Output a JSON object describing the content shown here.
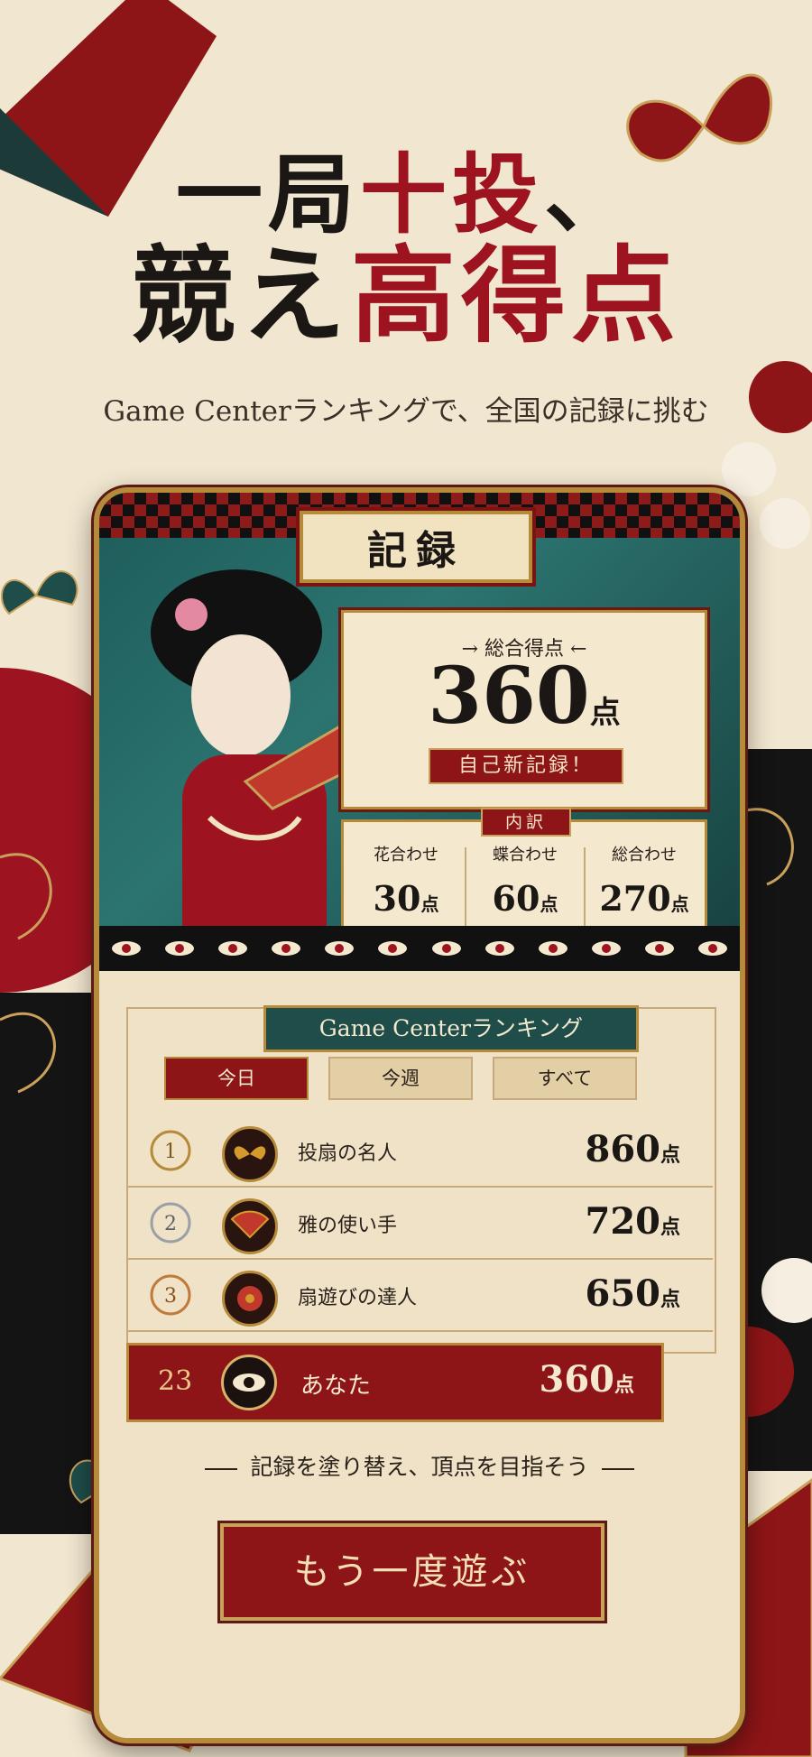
{
  "headline": {
    "line1_a": "一局",
    "line1_b": "十投",
    "line1_c": "、",
    "line2_a": "競え",
    "line2_b": "高得点",
    "subline": "Game Centerランキングで、全国の記録に挑む"
  },
  "record": {
    "title": "記録",
    "total_label": "→ 総合得点 ←",
    "total_value": "360",
    "total_unit": "点",
    "new_record": "自己新記録！",
    "breakdown_tag": "内訳",
    "breakdown": [
      {
        "name": "花合わせ",
        "value": "30",
        "unit": "点"
      },
      {
        "name": "蝶合わせ",
        "value": "60",
        "unit": "点"
      },
      {
        "name": "総合わせ",
        "value": "270",
        "unit": "点"
      }
    ]
  },
  "ranking": {
    "title": "Game Centerランキング",
    "tabs": [
      "今日",
      "今週",
      "すべて"
    ],
    "active_tab": "今日",
    "rows": [
      {
        "rank": "1",
        "name": "投扇の名人",
        "score": "860",
        "unit": "点",
        "icon": "butterfly-icon"
      },
      {
        "rank": "2",
        "name": "雅の使い手",
        "score": "720",
        "unit": "点",
        "icon": "fan-icon"
      },
      {
        "rank": "3",
        "name": "扇遊びの達人",
        "score": "650",
        "unit": "点",
        "icon": "flower-icon"
      }
    ],
    "me": {
      "rank": "23",
      "name": "あなた",
      "score": "360",
      "unit": "点",
      "icon": "eye-icon"
    }
  },
  "motto": "記録を塗り替え、頂点を目指そう",
  "cta_label": "もう一度遊ぶ",
  "colors": {
    "crimson": "#9d1420",
    "gold": "#b58a3a",
    "teal": "#1e4d4a",
    "cream": "#efe2c6"
  }
}
